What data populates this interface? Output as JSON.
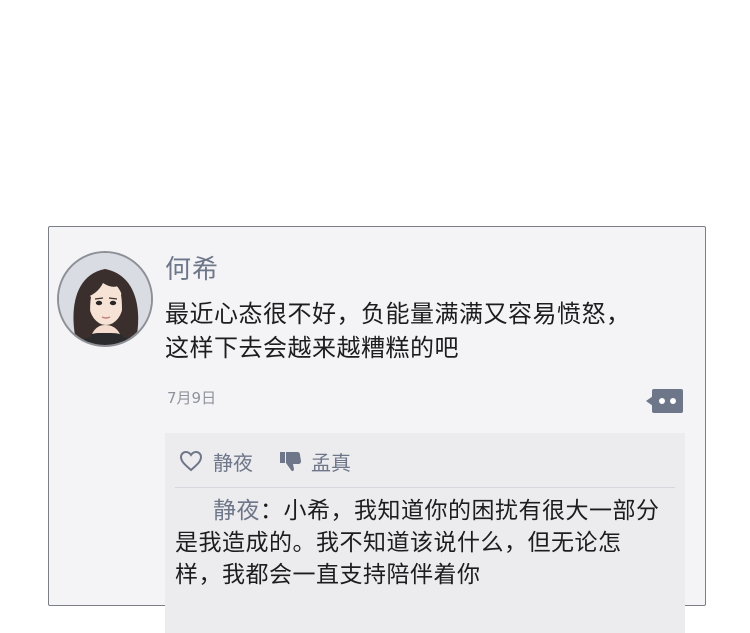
{
  "post": {
    "author": "何希",
    "text_line1": "最近心态很不好，负能量满满又容易愤怒，",
    "text_line2": "这样下去会越来越糟糕的吧",
    "date": "7月9日"
  },
  "interactions": {
    "like_user": "静夜",
    "dislike_user": "孟真"
  },
  "reply": {
    "author": "静夜",
    "text": "：小希，我知道你的困扰有很大一部分是我造成的。我不知道该说什么，但无论怎样，我都会一直支持陪伴着你"
  },
  "colors": {
    "accent": "#6e7689",
    "card_bg": "#f4f4f6",
    "panel_bg": "#ececef"
  }
}
